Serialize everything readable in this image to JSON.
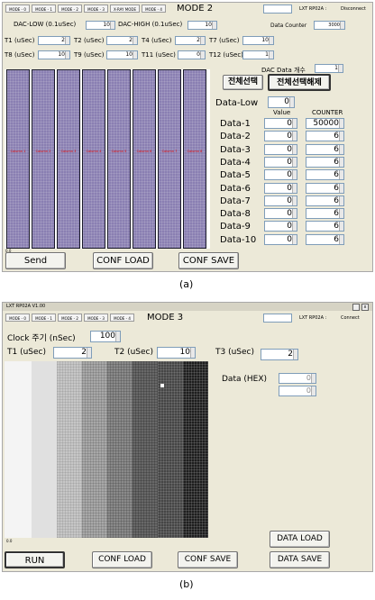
{
  "panel_a": {
    "tabs": [
      "MODE - 0",
      "MODE - 1",
      "MODE - 2",
      "MODE - 3",
      "X-RAY MODE",
      "MODE - 4"
    ],
    "mode_title": "MODE 2",
    "device": "LXT RP02A :",
    "status": "Disconnect",
    "dac_low_label": "DAC-LOW (0.1uSec)",
    "dac_low_value": "10",
    "dac_high_label": "DAC-HIGH (0.1uSec)",
    "dac_high_value": "10",
    "data_counter_label": "Data Counter",
    "data_counter_value": "3000",
    "t_params": [
      {
        "label": "T1 (uSec)",
        "value": "2"
      },
      {
        "label": "T2 (uSec)",
        "value": "2"
      },
      {
        "label": "T4 (uSec)",
        "value": "2"
      },
      {
        "label": "T7 (uSec)",
        "value": "10"
      },
      {
        "label": "T8 (uSec)",
        "value": "10"
      },
      {
        "label": "T9 (uSec)",
        "value": "10"
      },
      {
        "label": "T11 (uSec)",
        "value": "0"
      },
      {
        "label": "T12 (uSec)",
        "value": "1"
      }
    ],
    "dac_count_label": "DAC  Data  개수",
    "dac_count_value": "1",
    "select_all": "전체선택",
    "deselect_all": "전체선택해제",
    "data_low_label": "Data-Low",
    "data_low_value": "0",
    "value_header": "Value",
    "counter_header": "COUNTER",
    "rows": [
      {
        "label": "Data-1",
        "value": "0",
        "counter": "50000"
      },
      {
        "label": "Data-2",
        "value": "0",
        "counter": "6"
      },
      {
        "label": "Data-3",
        "value": "0",
        "counter": "6"
      },
      {
        "label": "Data-4",
        "value": "0",
        "counter": "6"
      },
      {
        "label": "Data-5",
        "value": "0",
        "counter": "6"
      },
      {
        "label": "Data-6",
        "value": "0",
        "counter": "6"
      },
      {
        "label": "Data-7",
        "value": "0",
        "counter": "6"
      },
      {
        "label": "Data-8",
        "value": "0",
        "counter": "6"
      },
      {
        "label": "Data-9",
        "value": "0",
        "counter": "6"
      },
      {
        "label": "Data-10",
        "value": "0",
        "counter": "6"
      }
    ],
    "column_labels": [
      "Column 1",
      "Column 2",
      "Column 3",
      "Column 4",
      "Column 5",
      "Column 6",
      "Column 7",
      "Column 8"
    ],
    "corner_value": "0.0",
    "send": "Send",
    "conf_load": "CONF LOAD",
    "conf_save": "CONF SAVE"
  },
  "caption_a": "(a)",
  "panel_b": {
    "title_bar": "LXT RP02A V1.00",
    "tabs": [
      "MODE - 0",
      "MODE - 1",
      "MODE - 2",
      "MODE - 3",
      "MODE - 4"
    ],
    "mode_title": "MODE 3",
    "device": "LXT RP02A :",
    "status": "Connect",
    "clock_label": "Clock 주기 (nSec)",
    "clock_value": "100",
    "t1_label": "T1 (uSec)",
    "t1_value": "2",
    "t2_label": "T2 (uSec)",
    "t2_value": "10",
    "t3_label": "T3 (uSec)",
    "t3_value": "2",
    "data_hex_label": "Data  (HEX)",
    "hex_values": [
      "0",
      "0"
    ],
    "corner_value": "0.0",
    "run": "RUN",
    "conf_load": "CONF LOAD",
    "conf_save": "CONF SAVE",
    "data_load": "DATA LOAD",
    "data_save": "DATA SAVE"
  },
  "caption_b": "(b)",
  "colors": {
    "panel_bg": "#ece9d8",
    "plot_purple": "#8a7fb2",
    "label_red": "#e00000"
  }
}
